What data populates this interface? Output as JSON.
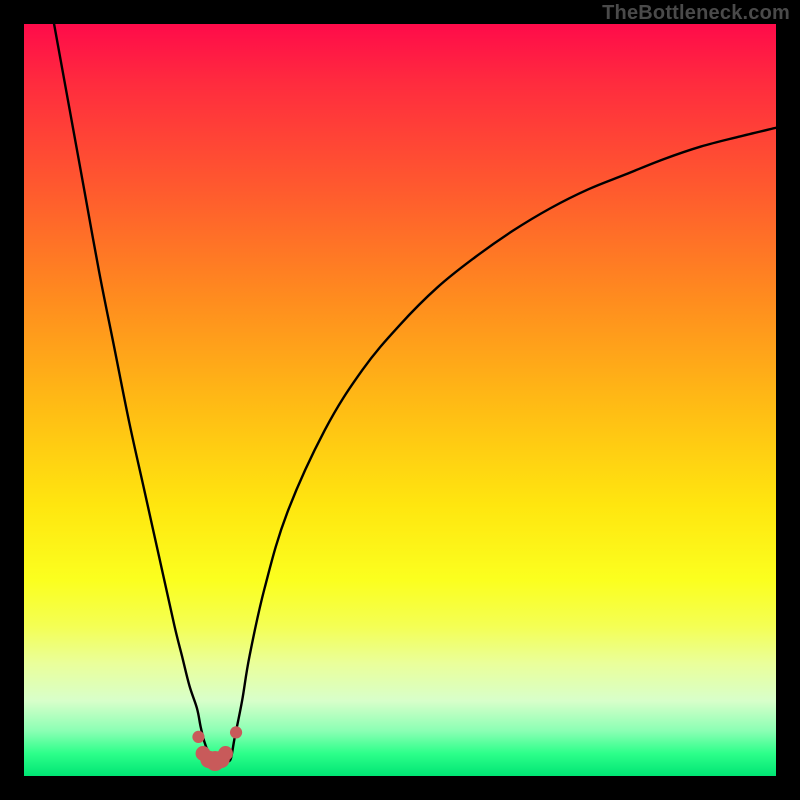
{
  "watermark": "TheBottleneck.com",
  "chart_data": {
    "type": "line",
    "title": "",
    "xlabel": "",
    "ylabel": "",
    "xlim": [
      0,
      100
    ],
    "ylim": [
      0,
      100
    ],
    "series": [
      {
        "name": "left-falling-curve",
        "x": [
          4,
          6,
          8,
          10,
          12,
          14,
          16,
          18,
          20,
          21,
          22,
          23,
          23.5,
          24,
          24.5,
          25,
          25.5,
          26
        ],
        "y": [
          100,
          89,
          78,
          67,
          57,
          47,
          38,
          29,
          20,
          16,
          12,
          9,
          6.5,
          4.5,
          3.2,
          2.3,
          2,
          2
        ]
      },
      {
        "name": "right-rising-curve",
        "x": [
          27,
          27.5,
          28,
          29,
          30,
          32,
          35,
          40,
          45,
          50,
          55,
          60,
          65,
          70,
          75,
          80,
          85,
          90,
          95,
          100
        ],
        "y": [
          2,
          2.3,
          5,
          10,
          16,
          25,
          35,
          46,
          54,
          60,
          65,
          69,
          72.5,
          75.5,
          78,
          80,
          82,
          83.7,
          85,
          86.2
        ]
      },
      {
        "name": "trough-markers",
        "x": [
          23.2,
          23.8,
          24.6,
          25.4,
          26.2,
          26.8,
          28.2
        ],
        "y": [
          5.2,
          3.0,
          2.2,
          2.0,
          2.2,
          3.0,
          5.8
        ]
      }
    ],
    "marker_color": "#c85a5a",
    "line_color": "#000000"
  }
}
